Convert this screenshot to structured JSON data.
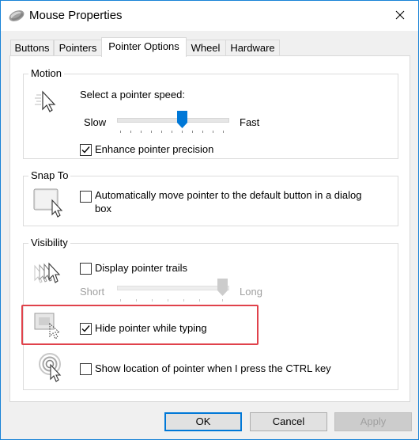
{
  "window": {
    "title": "Mouse Properties"
  },
  "tabs": [
    {
      "label": "Buttons"
    },
    {
      "label": "Pointers"
    },
    {
      "label": "Pointer Options"
    },
    {
      "label": "Wheel"
    },
    {
      "label": "Hardware"
    }
  ],
  "active_tab": "Pointer Options",
  "motion": {
    "group_label": "Motion",
    "speed_label": "Select a pointer speed:",
    "slow_label": "Slow",
    "fast_label": "Fast",
    "speed_value": 0.6,
    "enhance_precision": {
      "label": "Enhance pointer precision",
      "checked": true
    }
  },
  "snap_to": {
    "group_label": "Snap To",
    "auto_move": {
      "label_line1": "Automatically move pointer to the default button in a dialog",
      "label_line2": "box",
      "checked": false
    }
  },
  "visibility": {
    "group_label": "Visibility",
    "trails": {
      "label": "Display pointer trails",
      "checked": false
    },
    "short_label": "Short",
    "long_label": "Long",
    "trail_length": 1.0,
    "hide_typing": {
      "label": "Hide pointer while typing",
      "checked": true
    },
    "show_location": {
      "label": "Show location of pointer when I press the CTRL key",
      "checked": false
    }
  },
  "buttons": {
    "ok": "OK",
    "cancel": "Cancel",
    "apply": "Apply"
  },
  "colors": {
    "accent": "#0078d7",
    "highlight_box": "#e0424b"
  },
  "icons": {
    "title": "mouse-icon",
    "close": "close-icon",
    "motion": "pointer-speed-icon",
    "snap_to": "snap-to-button-icon",
    "trails": "pointer-trails-icon",
    "hide_typing": "hide-pointer-icon",
    "show_location": "pointer-location-icon"
  }
}
